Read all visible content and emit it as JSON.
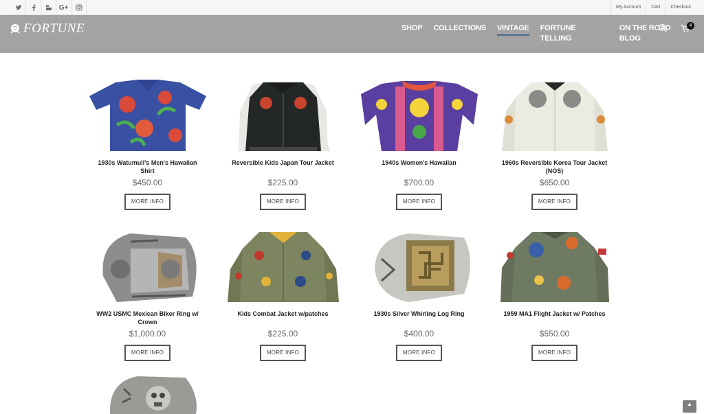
{
  "topbar": {
    "social": [
      {
        "icon": "twitter-icon"
      },
      {
        "icon": "facebook-icon"
      },
      {
        "icon": "youtube-icon"
      },
      {
        "icon": "google-plus-icon",
        "label": "G+"
      },
      {
        "icon": "instagram-icon"
      }
    ],
    "links": [
      "My Account",
      "Cart",
      "Checkout"
    ]
  },
  "header": {
    "logo_text": "FORTUNE",
    "nav": [
      "SHOP",
      "COLLECTIONS",
      "VINTAGE",
      "FORTUNE TELLING",
      "ON THE ROAD BLOG"
    ],
    "active_nav": "VINTAGE",
    "cart_count": "4"
  },
  "products": [
    {
      "title": "1930s Watumull's Men's Hawaiian Shirt",
      "price": "$450.00",
      "button": "MORE INFO"
    },
    {
      "title": "Reversible Kids Japan Tour Jacket",
      "price": "$225.00",
      "button": "MORE INFO"
    },
    {
      "title": "1940s Women's Hawaiian",
      "price": "$700.00",
      "button": "MORE INFO"
    },
    {
      "title": "1960s Reversible Korea Tour Jacket (NOS)",
      "price": "$650.00",
      "button": "MORE INFO"
    },
    {
      "title": "WW2 USMC Mexican Biker Ring w/ Crown",
      "price": "$1,000.00",
      "button": "MORE INFO"
    },
    {
      "title": "Kids Combat Jacket w/patches",
      "price": "$225.00",
      "button": "MORE INFO"
    },
    {
      "title": "1930s Silver Whirling Log Ring",
      "price": "$400.00",
      "button": "MORE INFO"
    },
    {
      "title": "1959 MA1 Flight Jacket w/ Patches",
      "price": "$550.00",
      "button": "MORE INFO"
    }
  ],
  "colors": {
    "header_bg": "#a3a3a3",
    "nav_active_underline": "#4b6a8f",
    "button_border": "#555555"
  }
}
